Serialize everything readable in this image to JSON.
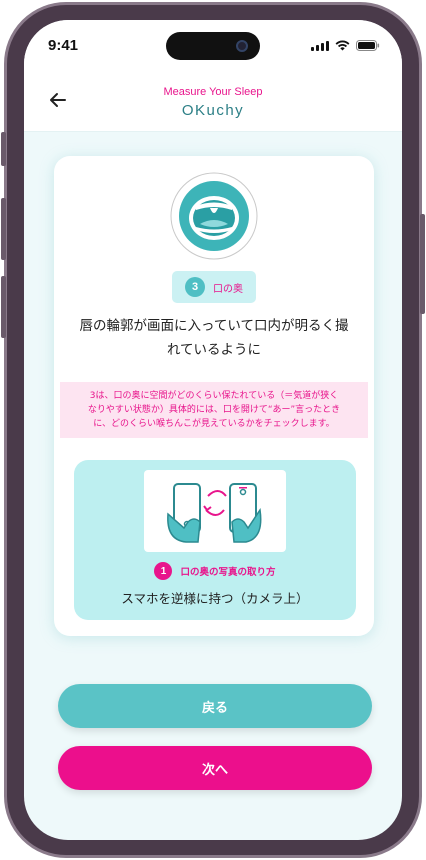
{
  "status_bar": {
    "time": "9:41",
    "icons": [
      "cellular-signal-icon",
      "wifi-icon",
      "battery-icon"
    ]
  },
  "header": {
    "subtitle": "Measure Your Sleep",
    "brand": "OKuchy",
    "back_icon": "back-arrow-icon"
  },
  "card": {
    "illustration": "open-mouth-icon",
    "step_number": "3",
    "step_label": "口の奥",
    "instruction_line1": "唇の輪郭が画面に入っていて口内が明るく撮",
    "instruction_line2": "れているように",
    "note_line1": "3は、口の奥に空間がどのくらい保たれている（＝気道が狭く",
    "note_line2": "なりやすい状態か）具体的には、口を開けて“あー”言ったとき",
    "note_line3": "に、どのくらい喉ちんこが見えているかをチェックします。",
    "tip": {
      "illustration": "rotate-phone-upside-down-icon",
      "number": "1",
      "title": "口の奥の写真の取り方",
      "text": "スマホを逆様に持つ（カメラ上）"
    }
  },
  "buttons": {
    "back_label": "戻る",
    "next_label": "次へ"
  },
  "colors": {
    "accent_pink": "#ec0f8c",
    "accent_teal": "#5ac3c6",
    "tip_background": "#bdeff0",
    "note_background": "#fde4f1",
    "screen_background": "#eef9fa"
  }
}
